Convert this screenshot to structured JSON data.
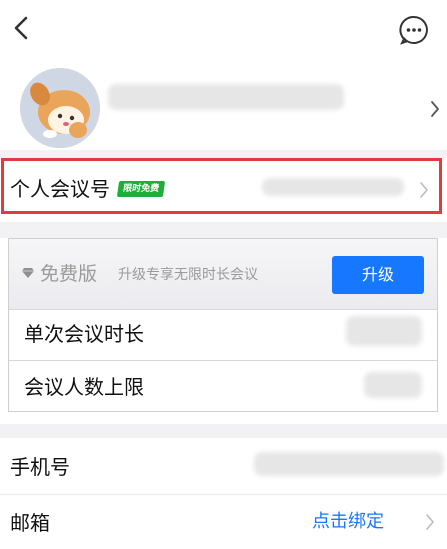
{
  "header": {
    "back_icon": "chevron-left-icon",
    "more_icon": "chat-more-icon"
  },
  "profile": {
    "avatar_icon": "cartoon-avatar",
    "chevron_icon": "chevron-right-icon"
  },
  "personal_meeting": {
    "label": "个人会议号",
    "badge": "限时免费",
    "chevron_icon": "chevron-right-icon",
    "highlight_color": "#e23b3b"
  },
  "plan": {
    "icon": "diamond-icon",
    "name": "免费版",
    "description": "升级专享无限时长会议",
    "upgrade_button": "升级",
    "rows": [
      {
        "label": "单次会议时长"
      },
      {
        "label": "会议人数上限"
      }
    ]
  },
  "account": {
    "phone_label": "手机号",
    "email_label": "邮箱",
    "email_action": "点击绑定",
    "chevron_icon": "chevron-right-icon"
  },
  "colors": {
    "accent": "#1677ff",
    "badge": "#1fae3a",
    "highlight": "#e23b3b",
    "divider_band": "#f2f2f4"
  }
}
